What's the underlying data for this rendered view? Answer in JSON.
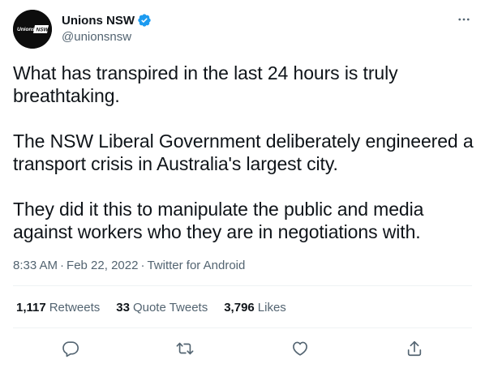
{
  "author": {
    "display_name": "Unions NSW",
    "handle": "@unionsnsw",
    "avatar_text": "Unions NSW",
    "verified": true
  },
  "tweet": {
    "paragraphs": [
      "What has transpired in the last 24 hours is truly breathtaking.",
      "The NSW Liberal Government deliberately engineered a transport crisis in Australia's largest city.",
      "They did it this to manipulate the public and media against workers who they are in negotiations with."
    ]
  },
  "meta": {
    "time": "8:33 AM",
    "date": "Feb 22, 2022",
    "source": "Twitter for Android",
    "separator": "·"
  },
  "stats": {
    "retweets_count": "1,117",
    "retweets_label": "Retweets",
    "quotes_count": "33",
    "quotes_label": "Quote Tweets",
    "likes_count": "3,796",
    "likes_label": "Likes"
  },
  "icons": {
    "more": "more-horizontal-icon",
    "verified": "verified-badge-icon",
    "reply": "reply-icon",
    "retweet": "retweet-icon",
    "like": "heart-icon",
    "share": "share-icon"
  },
  "colors": {
    "text_primary": "#0f1419",
    "text_secondary": "#536471",
    "verified_blue": "#1d9bf0",
    "divider": "#eff3f4",
    "avatar_bg": "#0d0d0d"
  }
}
